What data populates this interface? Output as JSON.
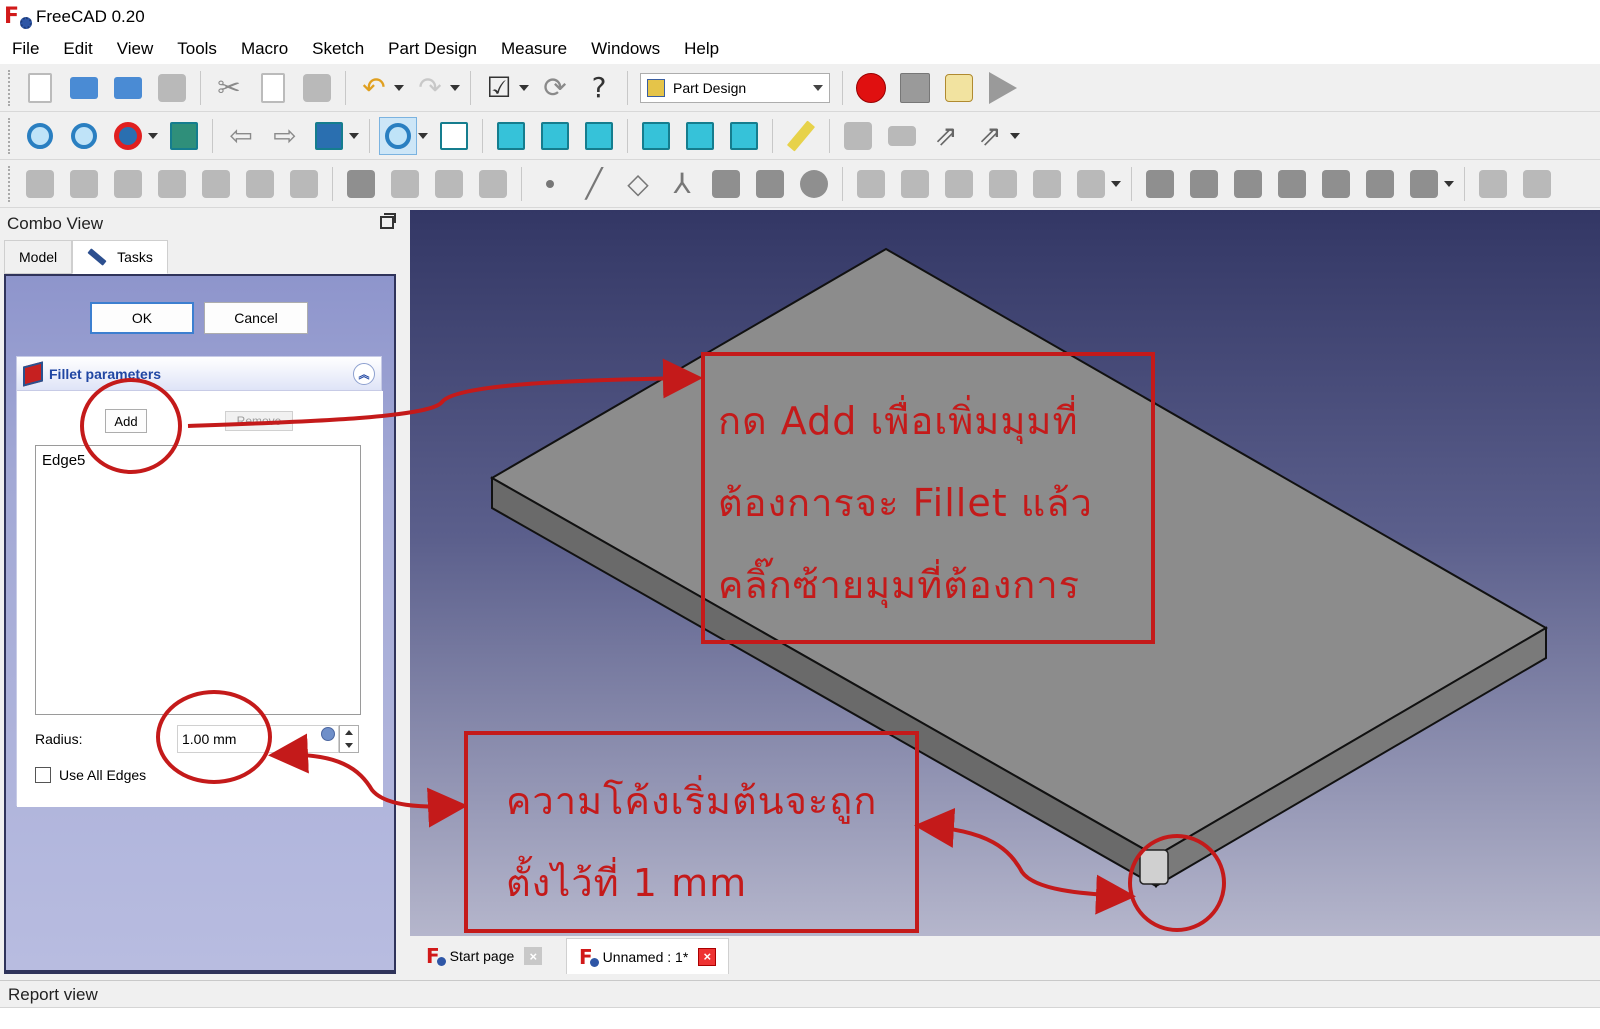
{
  "window": {
    "title": "FreeCAD 0.20"
  },
  "menu": [
    "File",
    "Edit",
    "View",
    "Tools",
    "Macro",
    "Sketch",
    "Part Design",
    "Measure",
    "Windows",
    "Help"
  ],
  "toolbar": {
    "workbench": "Part Design"
  },
  "combo": {
    "title": "Combo View",
    "tabs": [
      "Model",
      "Tasks"
    ],
    "ok_label": "OK",
    "cancel_label": "Cancel",
    "panel_title": "Fillet parameters",
    "add_label": "Add",
    "remove_label": "Remove",
    "edges": [
      "Edge5"
    ],
    "radius_label": "Radius:",
    "radius_value": "1.00 mm",
    "use_all_edges": "Use All Edges"
  },
  "doc_tabs": [
    "Start page",
    "Unnamed : 1*"
  ],
  "report": {
    "label": "Report view"
  },
  "annotations": {
    "note1": [
      "กด  Add  เพื่อเพิ่มมุมที่",
      "ต้องการจะ  Fillet  แล้ว",
      "คลิ๊กซ้ายมุมที่ต้องการ"
    ],
    "note2": [
      "ความโค้งเริ่มต้นจะถูก",
      "ตั้งไว้ที่  1  mm"
    ]
  },
  "colors": {
    "annotation_red": "#c41a1a",
    "view_top": "#333765",
    "view_bottom": "#b5b6cc",
    "plate_top": "#8c8c8c"
  }
}
